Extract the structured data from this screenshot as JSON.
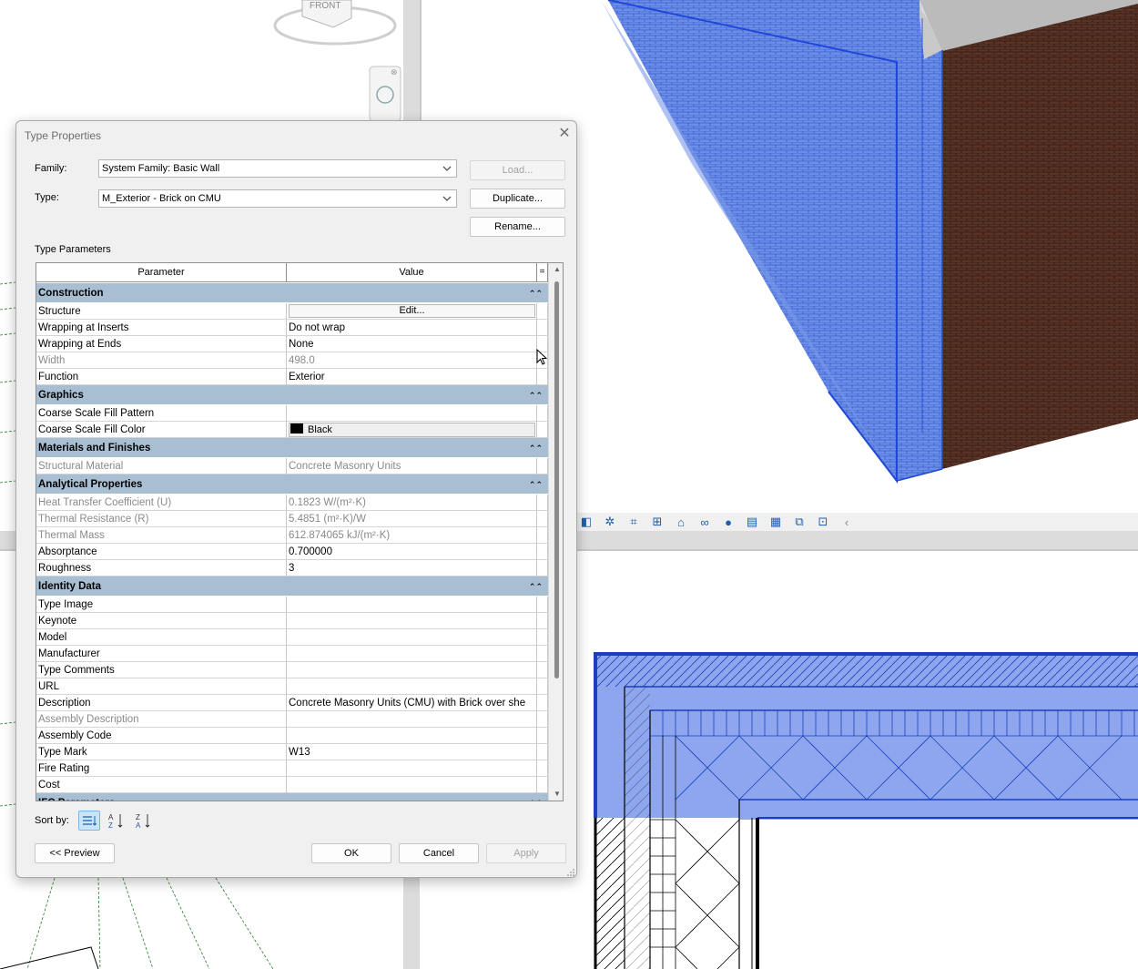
{
  "viewport": {
    "viewcube_label": "FRONT"
  },
  "dialog": {
    "title": "Type Properties",
    "family_label": "Family:",
    "family_value": "System Family: Basic Wall",
    "type_label": "Type:",
    "type_value": "M_Exterior - Brick on CMU",
    "load_button": "Load...",
    "duplicate_button": "Duplicate...",
    "rename_button": "Rename...",
    "type_parameters_label": "Type Parameters",
    "columns": {
      "parameter": "Parameter",
      "value": "Value",
      "equals": "="
    },
    "groups": [
      {
        "name": "Construction",
        "rows": [
          {
            "name": "Structure",
            "value": "Edit...",
            "kind": "button"
          },
          {
            "name": "Wrapping at Inserts",
            "value": "Do not wrap"
          },
          {
            "name": "Wrapping at Ends",
            "value": "None"
          },
          {
            "name": "Width",
            "value": "498.0",
            "readonly": true
          },
          {
            "name": "Function",
            "value": "Exterior"
          }
        ]
      },
      {
        "name": "Graphics",
        "rows": [
          {
            "name": "Coarse Scale Fill Pattern",
            "value": ""
          },
          {
            "name": "Coarse Scale Fill Color",
            "value": "Black",
            "kind": "color"
          }
        ]
      },
      {
        "name": "Materials and Finishes",
        "rows": [
          {
            "name": "Structural Material",
            "value": "Concrete Masonry Units",
            "readonly": true
          }
        ]
      },
      {
        "name": "Analytical Properties",
        "rows": [
          {
            "name": "Heat Transfer Coefficient (U)",
            "value": "0.1823 W/(m²·K)",
            "readonly": true
          },
          {
            "name": "Thermal Resistance (R)",
            "value": "5.4851 (m²·K)/W",
            "readonly": true
          },
          {
            "name": "Thermal Mass",
            "value": "612.874065 kJ/(m²·K)",
            "readonly": true
          },
          {
            "name": "Absorptance",
            "value": "0.700000"
          },
          {
            "name": "Roughness",
            "value": "3"
          }
        ]
      },
      {
        "name": "Identity Data",
        "rows": [
          {
            "name": "Type Image",
            "value": ""
          },
          {
            "name": "Keynote",
            "value": ""
          },
          {
            "name": "Model",
            "value": ""
          },
          {
            "name": "Manufacturer",
            "value": ""
          },
          {
            "name": "Type Comments",
            "value": ""
          },
          {
            "name": "URL",
            "value": ""
          },
          {
            "name": "Description",
            "value": "Concrete Masonry Units (CMU) with Brick over she"
          },
          {
            "name": "Assembly Description",
            "value": "",
            "readonly": true
          },
          {
            "name": "Assembly Code",
            "value": ""
          },
          {
            "name": "Type Mark",
            "value": "W13"
          },
          {
            "name": "Fire Rating",
            "value": ""
          },
          {
            "name": "Cost",
            "value": ""
          }
        ]
      },
      {
        "name": "IFC Parameters",
        "rows": []
      }
    ],
    "sort_label": "Sort by:",
    "preview_button": "<< Preview",
    "ok_button": "OK",
    "cancel_button": "Cancel",
    "apply_button": "Apply"
  },
  "colors": {
    "selection_blue": "#4a6fdc",
    "brick": "#5a3326",
    "group_header": "#a8bfd3",
    "dialog_bg": "#f0f0f0"
  }
}
